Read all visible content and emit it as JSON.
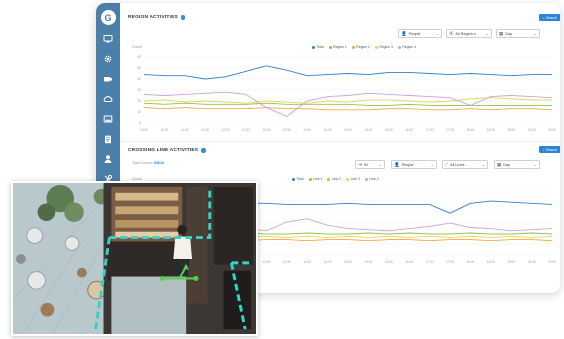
{
  "app": {
    "logo_glyph": "G",
    "accent": "#2c84d4",
    "sidebar_color": "#4b7fa8"
  },
  "sidebar": {
    "items": [
      {
        "icon": "monitor-icon"
      },
      {
        "icon": "gear-icon"
      },
      {
        "icon": "camera-icon"
      },
      {
        "icon": "cloud-icon"
      },
      {
        "icon": "image-icon"
      },
      {
        "icon": "clipboard-icon"
      },
      {
        "icon": "user-icon"
      },
      {
        "icon": "tools-icon"
      }
    ]
  },
  "region_panel": {
    "title": "REGION ACTIVITIES",
    "search_label": "Search",
    "filters": {
      "object": "People",
      "region": "All Region s",
      "period": "Day"
    },
    "y_axis_label": "Count",
    "legend": [
      "Total",
      "Region 1",
      "Region 2",
      "Region 3",
      "Region 4"
    ]
  },
  "crossing_panel": {
    "title": "CROSSING LINE ACTIVITIES",
    "search_label": "Search",
    "total_label": "Total Counts:",
    "total_value": "83616",
    "filters": {
      "direction": "IN",
      "object": "People",
      "lines": "All Lines",
      "period": "Day"
    },
    "y_axis_label": "Count",
    "legend": [
      "Total",
      "Line 1",
      "Line 2",
      "Line 3",
      "Line 4"
    ]
  },
  "chart_data": [
    {
      "type": "line",
      "title": "REGION ACTIVITIES",
      "ylabel": "Count",
      "ylim": [
        0,
        60
      ],
      "yticks": [
        0,
        10,
        20,
        30,
        40,
        50,
        60
      ],
      "x": [
        "10:00",
        "10:30",
        "11:00",
        "11:30",
        "12:00",
        "12:30",
        "13:00",
        "13:30",
        "14:00",
        "14:30",
        "15:00",
        "15:30",
        "16:00",
        "16:30",
        "17:00",
        "17:30",
        "18:00",
        "18:30",
        "19:00",
        "19:30",
        "20:00"
      ],
      "legend_position": "top-right",
      "series": [
        {
          "name": "Total",
          "color": "#2f80d2",
          "values": [
            44,
            43,
            43,
            40,
            42,
            47,
            52,
            48,
            43,
            44,
            45,
            44,
            46,
            46,
            45,
            44,
            45,
            44,
            43,
            44,
            44
          ]
        },
        {
          "name": "Region 1",
          "color": "#8bc34a",
          "values": [
            18,
            17,
            18,
            17,
            17,
            17,
            18,
            17,
            17,
            17,
            17,
            16,
            16,
            17,
            16,
            16,
            16,
            16,
            16,
            16,
            16
          ]
        },
        {
          "name": "Region 2",
          "color": "#f4a93b",
          "values": [
            14,
            13,
            14,
            13,
            13,
            13,
            14,
            13,
            13,
            12,
            12,
            12,
            13,
            13,
            12,
            12,
            13,
            12,
            13,
            13,
            12
          ]
        },
        {
          "name": "Region 3",
          "color": "#f2d04e",
          "values": [
            20,
            21,
            19,
            20,
            19,
            18,
            20,
            19,
            18,
            20,
            19,
            21,
            21,
            20,
            19,
            20,
            22,
            23,
            22,
            21,
            21
          ]
        },
        {
          "name": "Region 4",
          "color": "#c9a3e0",
          "values": [
            26,
            25,
            26,
            27,
            28,
            26,
            14,
            6,
            20,
            24,
            25,
            27,
            26,
            25,
            24,
            23,
            16,
            24,
            25,
            24,
            23
          ]
        }
      ]
    },
    {
      "type": "line",
      "title": "CROSSING LINE ACTIVITIES",
      "ylabel": "Count",
      "x": [
        "10:00",
        "10:30",
        "11:00",
        "11:30",
        "12:00",
        "12:30",
        "13:00",
        "13:30",
        "14:00",
        "14:30",
        "15:00",
        "15:30",
        "16:00",
        "16:30",
        "17:00",
        "17:30",
        "18:00",
        "18:30",
        "19:00",
        "19:30",
        "20:00"
      ],
      "legend_position": "top",
      "series": [
        {
          "name": "Total",
          "color": "#2f80d2",
          "values": [
            46,
            46,
            47,
            46,
            46,
            47,
            47,
            46,
            46,
            46,
            47,
            46,
            46,
            46,
            46,
            38,
            47,
            49,
            48,
            47,
            46
          ]
        },
        {
          "name": "Line 1",
          "color": "#8bc34a",
          "values": [
            20,
            19,
            20,
            19,
            19,
            20,
            19,
            19,
            20,
            19,
            19,
            20,
            19,
            20,
            19,
            19,
            20,
            19,
            19,
            20,
            19
          ]
        },
        {
          "name": "Line 2",
          "color": "#f4a93b",
          "values": [
            14,
            14,
            13,
            14,
            14,
            13,
            14,
            14,
            13,
            14,
            14,
            13,
            14,
            14,
            13,
            14,
            14,
            13,
            14,
            14,
            13
          ]
        },
        {
          "name": "Line 3",
          "color": "#f2d04e",
          "values": [
            17,
            16,
            17,
            16,
            17,
            16,
            17,
            16,
            17,
            16,
            17,
            16,
            17,
            16,
            17,
            16,
            17,
            16,
            17,
            16,
            17
          ]
        },
        {
          "name": "Line 4",
          "color": "#c9a3e0",
          "values": [
            25,
            24,
            25,
            26,
            27,
            24,
            22,
            30,
            33,
            27,
            24,
            23,
            22,
            24,
            26,
            29,
            25,
            24,
            22,
            23,
            24
          ]
        }
      ]
    }
  ]
}
